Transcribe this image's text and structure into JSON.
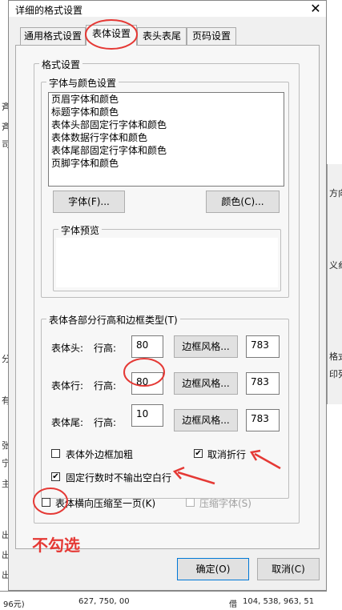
{
  "dialog": {
    "title": "详细的格式设置",
    "close_glyph": "✕"
  },
  "tabs": [
    {
      "label": "通用格式设置"
    },
    {
      "label": "表体设置"
    },
    {
      "label": "表头表尾"
    },
    {
      "label": "页码设置"
    }
  ],
  "format_group": {
    "label": "格式设置",
    "font_color_group": {
      "label": "字体与颜色设置",
      "items": [
        "页眉字体和颜色",
        "标题字体和颜色",
        "表体头部固定行字体和颜色",
        "表体数据行字体和颜色",
        "表体尾部固定行字体和颜色",
        "页脚字体和颜色"
      ],
      "font_button": "字体(F)...",
      "color_button": "颜色(C)...",
      "preview_label": "字体预览"
    },
    "rows_group": {
      "label": "表体各部分行高和边框类型(T)",
      "row_height_label": "行高:",
      "border_button": "边框风格...",
      "rows": [
        {
          "label": "表体头:",
          "height": "80",
          "border": "783"
        },
        {
          "label": "表体行:",
          "height": "80",
          "border": "783"
        },
        {
          "label": "表体尾:",
          "height": "10",
          "border": "783"
        }
      ],
      "bold_outer_border": {
        "label": "表体外边框加粗",
        "checked": false
      },
      "cancel_wrap": {
        "label": "取消折行",
        "checked": true
      },
      "no_blank_rows": {
        "label": "固定行数时不输出空白行",
        "checked": true
      }
    }
  },
  "compress_horizontal": {
    "label": "表体横向压缩至一页(K)",
    "checked": false
  },
  "compress_font": {
    "label": "压缩字体(S)",
    "checked": false
  },
  "buttons": {
    "ok": "确定(O)",
    "cancel": "取消(C)"
  },
  "annotation": {
    "text": "不勾选",
    "color": "#e53935"
  },
  "background": {
    "left_chars": [
      "斉",
      "斉",
      "司",
      "分",
      "有",
      "张",
      "宁",
      "主",
      "出",
      "出",
      "出"
    ],
    "right_texts": [
      "方向",
      "义纟",
      "格式",
      "印列"
    ],
    "bottom_texts": [
      "96元)",
      "627, 750, 00",
      "借",
      "104, 538, 963, 51"
    ]
  }
}
